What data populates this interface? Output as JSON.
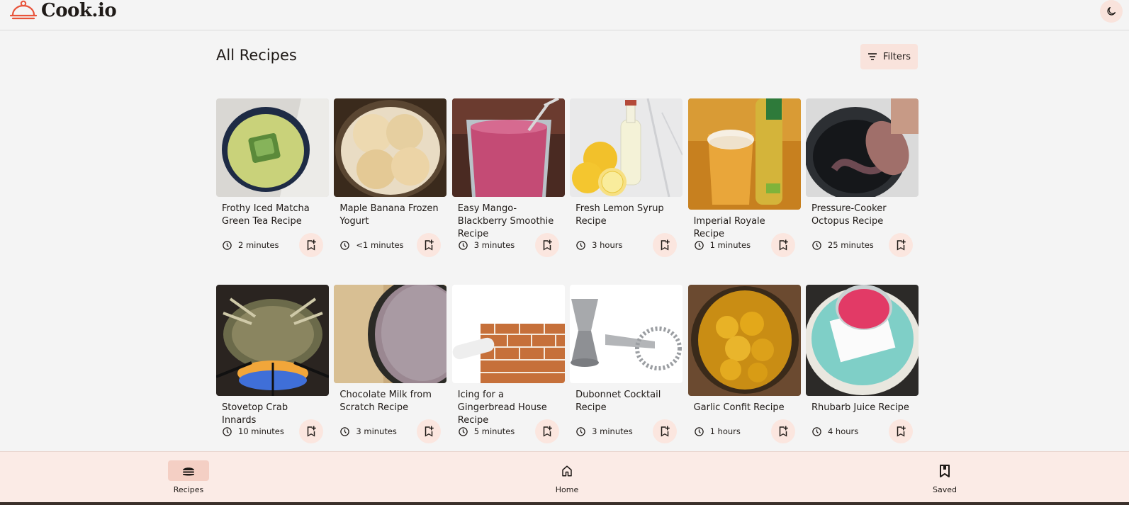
{
  "app": {
    "name": "Cook.io"
  },
  "header": {
    "theme_toggle_icon": "moon-icon"
  },
  "page": {
    "title": "All Recipes",
    "filters_label": "Filters"
  },
  "colors": {
    "accent": "#e8533a",
    "pill": "#f9e3dc",
    "nav_bg": "#fbebe6"
  },
  "recipes": [
    {
      "title": "Frothy Iced Matcha Green Tea Recipe",
      "time": "2 minutes"
    },
    {
      "title": "Maple Banana Frozen Yogurt",
      "time": "<1 minutes"
    },
    {
      "title": "Easy Mango-Blackberry Smoothie Recipe",
      "time": "3 minutes"
    },
    {
      "title": "Fresh Lemon Syrup Recipe",
      "time": "3 hours"
    },
    {
      "title": "Imperial Royale Recipe",
      "time": "1 minutes"
    },
    {
      "title": "Pressure-Cooker Octopus Recipe",
      "time": "25 minutes"
    },
    {
      "title": "Stovetop Crab Innards",
      "time": "10 minutes"
    },
    {
      "title": "Chocolate Milk from Scratch Recipe",
      "time": "3 minutes"
    },
    {
      "title": "Icing for a Gingerbread House Recipe",
      "time": "5 minutes"
    },
    {
      "title": "Dubonnet Cocktail Recipe",
      "time": "3 minutes"
    },
    {
      "title": "Garlic Confit Recipe",
      "time": "1 hours"
    },
    {
      "title": "Rhubarb Juice Recipe",
      "time": "4 hours"
    }
  ],
  "bottom_nav": [
    {
      "label": "Recipes",
      "icon": "burger-icon",
      "active": true
    },
    {
      "label": "Home",
      "icon": "home-icon",
      "active": false
    },
    {
      "label": "Saved",
      "icon": "bookmark-icon",
      "active": false
    }
  ]
}
